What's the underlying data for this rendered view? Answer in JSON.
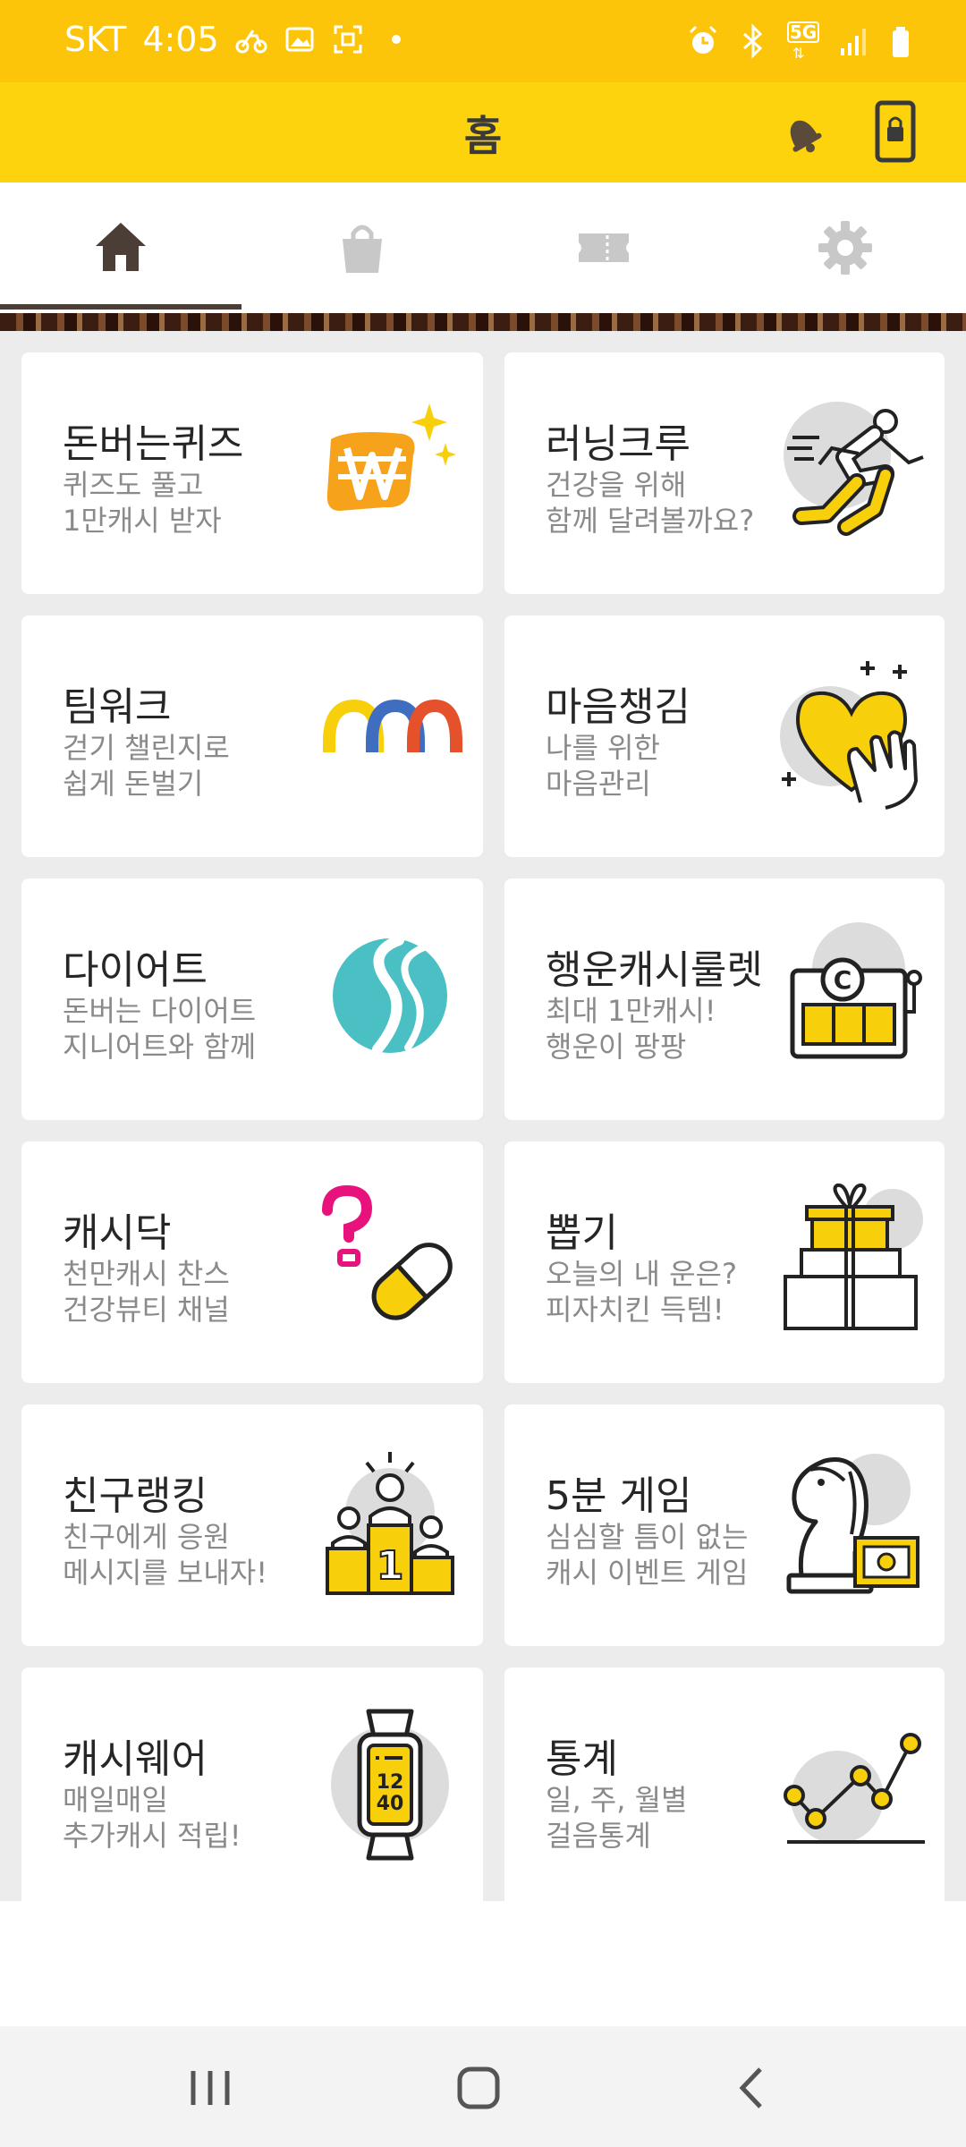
{
  "status_bar": {
    "carrier": "SKT",
    "time": "4:05",
    "network": "5G",
    "icons_left": [
      "cycling-icon",
      "gallery-icon",
      "screenshot-icon",
      "dot-icon"
    ],
    "icons_right": [
      "alarm-icon",
      "bluetooth-icon",
      "5g-icon",
      "signal-icon",
      "battery-icon"
    ]
  },
  "header": {
    "title": "홈",
    "bell_icon": "bell-icon",
    "lock_icon": "phone-lock-icon"
  },
  "tabs": [
    {
      "name": "home",
      "icon": "home-icon",
      "active": true
    },
    {
      "name": "shop",
      "icon": "shopping-bag-icon",
      "active": false
    },
    {
      "name": "coupon",
      "icon": "ticket-icon",
      "active": false
    },
    {
      "name": "settings",
      "icon": "gear-icon",
      "active": false
    }
  ],
  "cards": [
    {
      "title": "돈버는퀴즈",
      "line1": "퀴즈도 풀고",
      "line2": "1만캐시 받자",
      "icon": "won-sparkle-icon"
    },
    {
      "title": "러닝크루",
      "line1": "건강을 위해",
      "line2": "함께 달려볼까요?",
      "icon": "runner-icon"
    },
    {
      "title": "팀워크",
      "line1": "걷기 챌린지로",
      "line2": "쉽게 돈벌기",
      "icon": "teamwork-arches-icon"
    },
    {
      "title": "마음챙김",
      "line1": "나를 위한",
      "line2": "마음관리",
      "icon": "heart-hand-icon"
    },
    {
      "title": "다이어트",
      "line1": "돈버는 다이어트",
      "line2": "지니어트와 함께",
      "icon": "diet-logo-icon"
    },
    {
      "title": "행운캐시룰렛",
      "line1": "최대 1만캐시!",
      "line2": "행운이 팡팡",
      "icon": "slot-machine-icon"
    },
    {
      "title": "캐시닥",
      "line1": "천만캐시 찬스",
      "line2": "건강뷰티 채널",
      "icon": "pill-question-icon"
    },
    {
      "title": "뽑기",
      "line1": "오늘의 내 운은?",
      "line2": "피자치킨 득템!",
      "icon": "gift-box-icon"
    },
    {
      "title": "친구랭킹",
      "line1": "친구에게 응원",
      "line2": "메시지를 보내자!",
      "icon": "podium-icon"
    },
    {
      "title": "5분 게임",
      "line1": "심심할 틈이 없는",
      "line2": "캐시 이벤트 게임",
      "icon": "chess-knight-icon"
    },
    {
      "title": "캐시웨어",
      "line1": "매일매일",
      "line2": "추가캐시 적립!",
      "icon": "smartwatch-icon"
    },
    {
      "title": "통계",
      "line1": "일, 주, 월별",
      "line2": "걸음통계",
      "icon": "line-chart-icon"
    }
  ],
  "watch_hour": "12",
  "watch_minute": "40",
  "podium_rank": "1",
  "slot_coin": "C",
  "colors": {
    "status_bar": "#fcc50a",
    "app_bar": "#fcd30c",
    "accent_yellow": "#f8cf0b",
    "card_bg": "#ffffff",
    "grid_bg": "#ececec"
  },
  "nav_bar": {
    "recents": "recents-icon",
    "home": "home-circle-icon",
    "back": "back-icon"
  }
}
